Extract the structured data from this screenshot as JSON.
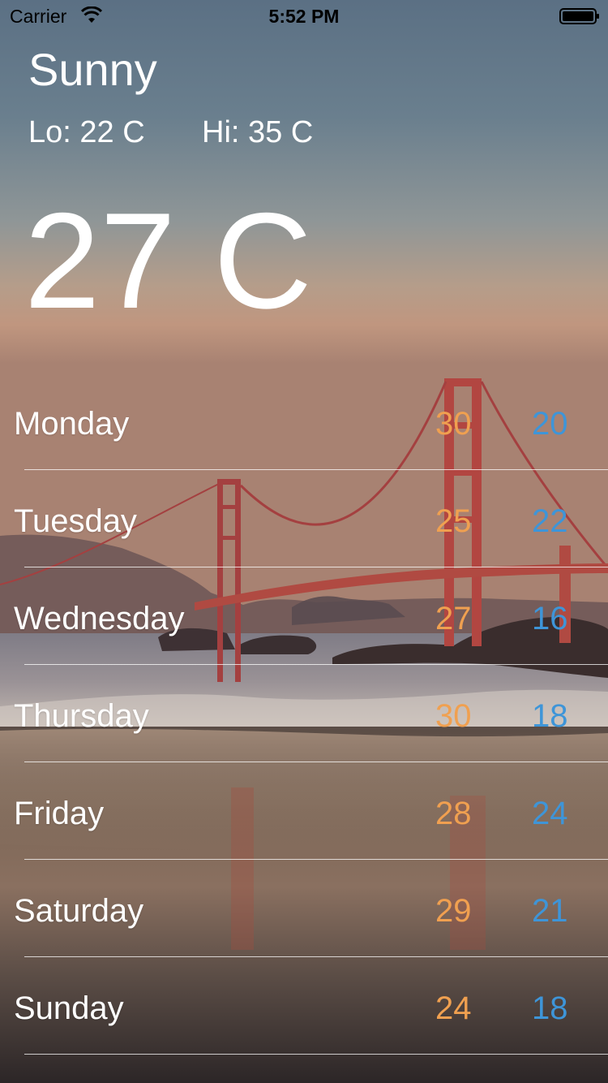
{
  "status_bar": {
    "carrier": "Carrier",
    "time": "5:52 PM",
    "icons": [
      "wifi-icon",
      "battery-icon"
    ]
  },
  "weather": {
    "condition": "Sunny",
    "lo": "Lo: 22 C",
    "hi": "Hi: 35 C",
    "current_temp": "27 C"
  },
  "forecast": [
    {
      "day": "Monday",
      "high": "30",
      "low": "20"
    },
    {
      "day": "Tuesday",
      "high": "25",
      "low": "22"
    },
    {
      "day": "Wednesday",
      "high": "27",
      "low": "16"
    },
    {
      "day": "Thursday",
      "high": "30",
      "low": "18"
    },
    {
      "day": "Friday",
      "high": "28",
      "low": "24"
    },
    {
      "day": "Saturday",
      "high": "29",
      "low": "21"
    },
    {
      "day": "Sunday",
      "high": "24",
      "low": "18"
    }
  ],
  "colors": {
    "high_temp": "#f0a050",
    "low_temp": "#3e95d8",
    "text": "#ffffff",
    "separator": "#ffffff"
  }
}
